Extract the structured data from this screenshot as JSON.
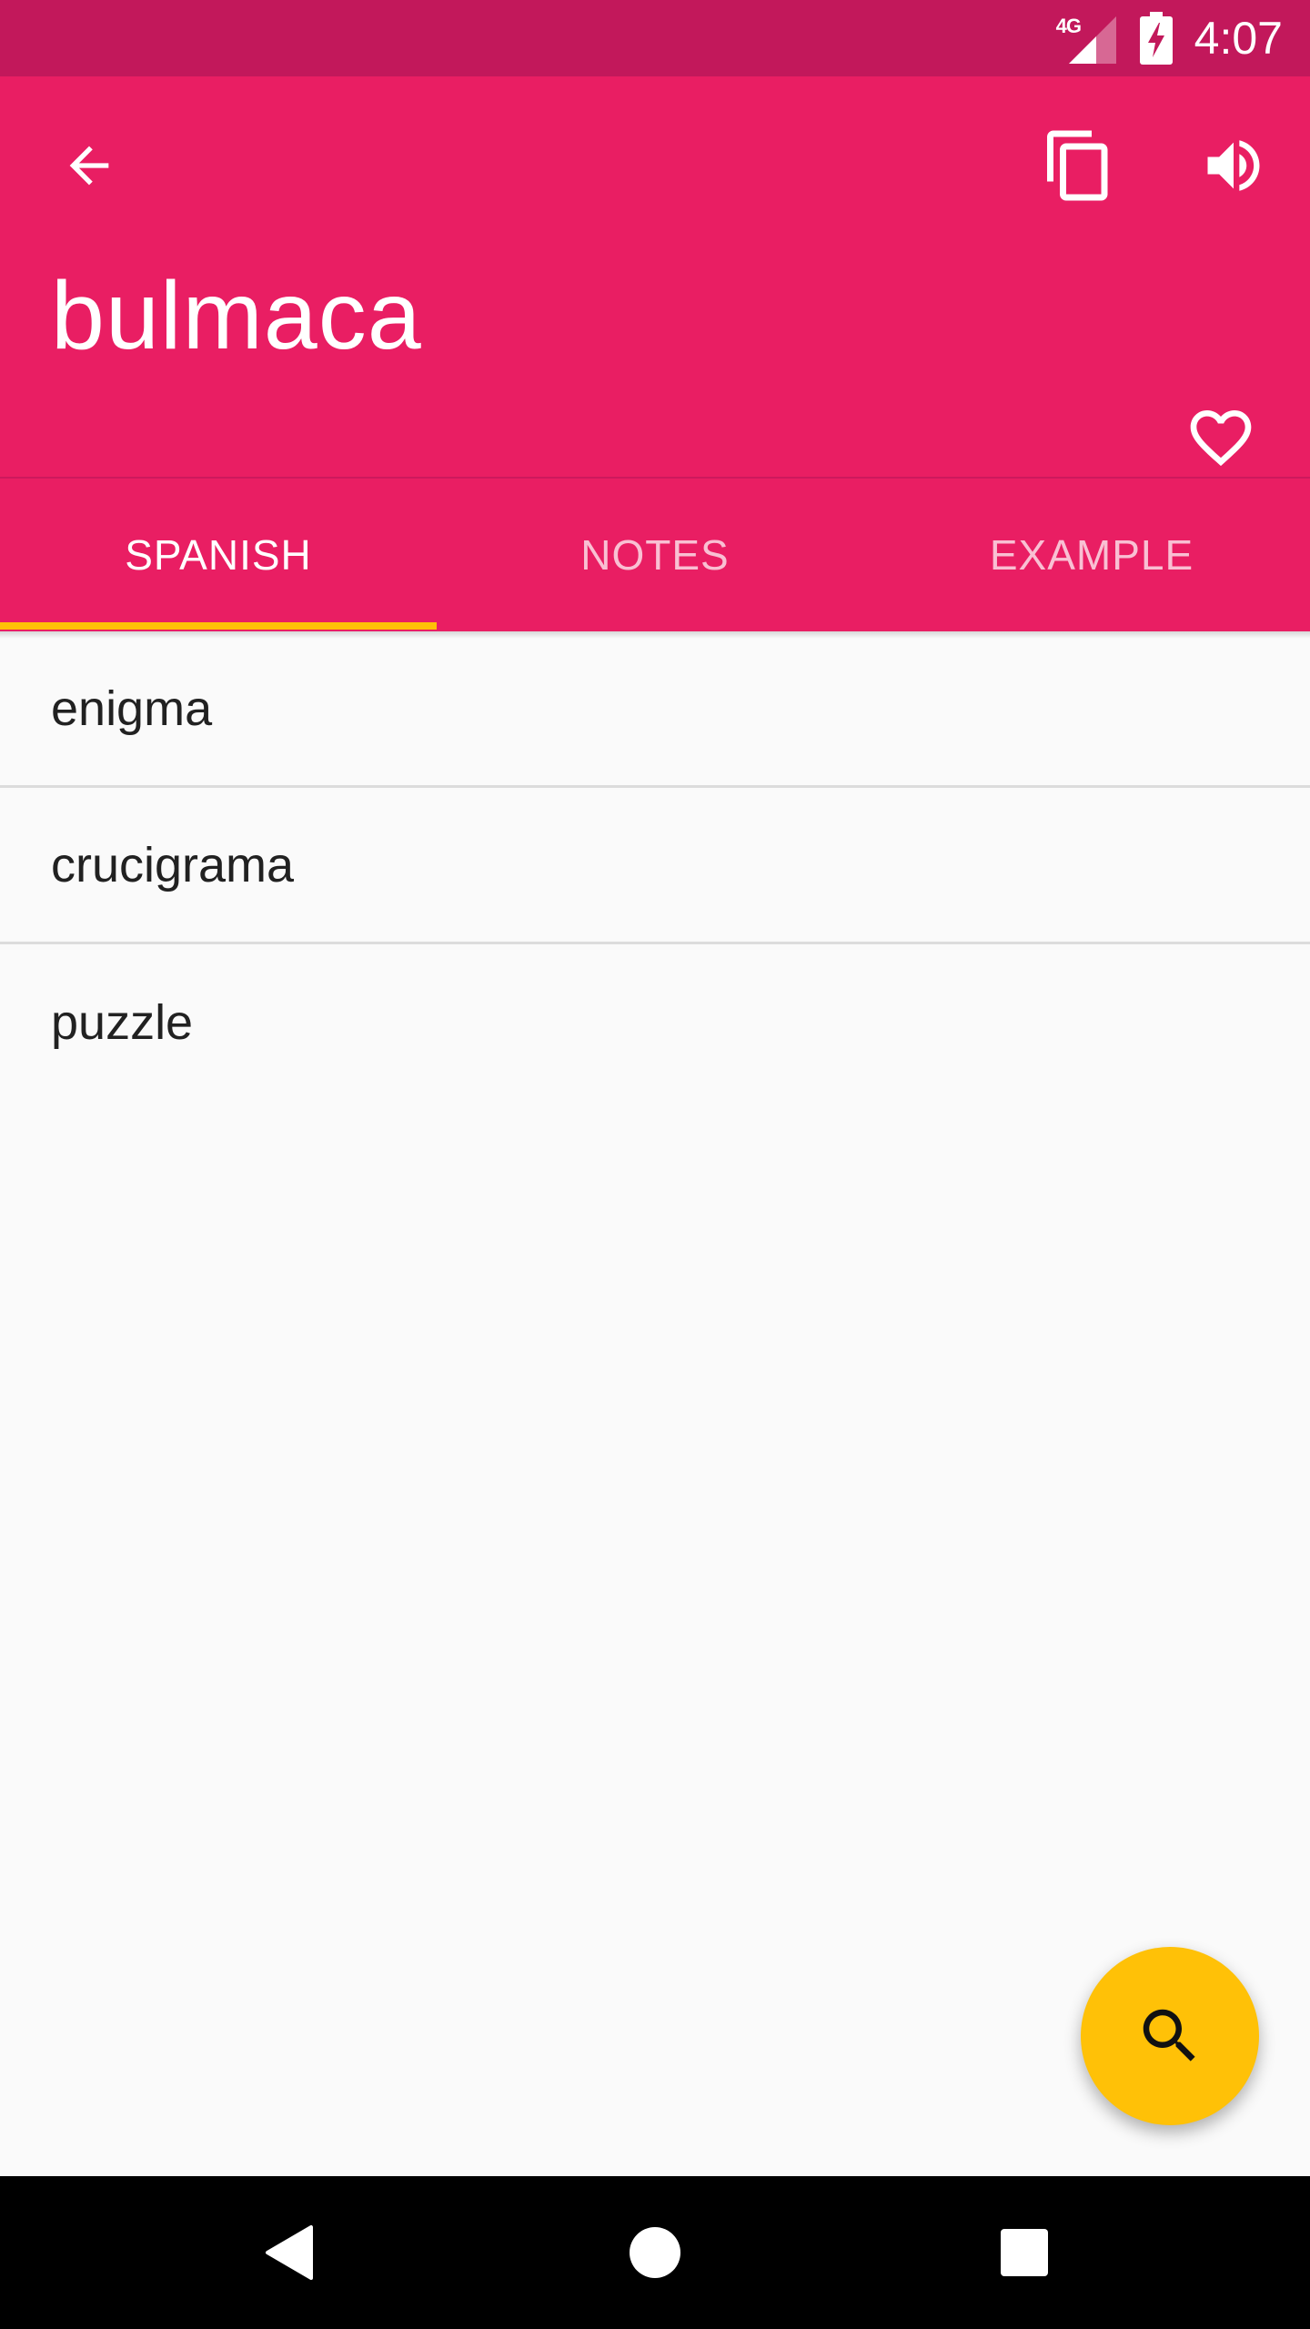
{
  "status_bar": {
    "network": "4G",
    "time": "4:07"
  },
  "app_bar": {
    "word": "bulmaca",
    "icons": {
      "back": "arrow-back-icon",
      "copy": "copy-icon",
      "speak": "volume-up-icon",
      "favorite": "heart-outline-icon"
    }
  },
  "tabs": [
    {
      "label": "SPANISH",
      "active": true
    },
    {
      "label": "NOTES",
      "active": false
    },
    {
      "label": "EXAMPLE",
      "active": false
    }
  ],
  "translations": [
    "enigma",
    "crucigrama",
    "puzzle"
  ],
  "fab": {
    "icon": "search-icon"
  },
  "nav_bar": {
    "icons": [
      "nav-back-icon",
      "nav-home-icon",
      "nav-recents-icon"
    ]
  },
  "colors": {
    "primary": "#e91e63",
    "primary_dark": "#c2185b",
    "accent": "#ffc107",
    "background": "#fafafa",
    "text": "#212121"
  }
}
